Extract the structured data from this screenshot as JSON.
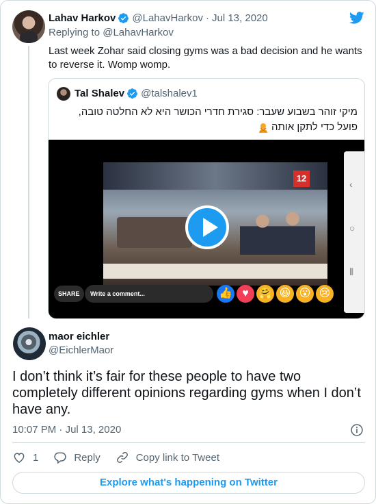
{
  "parent_tweet": {
    "name": "Lahav Harkov",
    "handle": "@LahavHarkov",
    "separator": "·",
    "date": "Jul 13, 2020",
    "replying_prefix": "Replying to",
    "replying_to": "@LahavHarkov",
    "text": "Last week Zohar said closing gyms was a bad decision and he wants to reverse it. Womp womp."
  },
  "quoted_tweet": {
    "name": "Tal Shalev",
    "handle": "@talshalev1",
    "text": "מיקי זוהר בשבוע שעבר: סגירת חדרי הכושר היא לא החלטה טובה, פועל כדי לתקן אותה",
    "video": {
      "share_label": "SHARE",
      "comment_placeholder": "Write a comment..."
    }
  },
  "reply_tweet": {
    "name": "maor eichler",
    "handle": "@EichlerMaor",
    "text": "I don’t think it’s fair for these people to have two completely different opinions regarding gyms when I don’t have any.",
    "time": "10:07 PM",
    "separator": "·",
    "date": "Jul 13, 2020"
  },
  "actions": {
    "like_count": "1",
    "reply_label": "Reply",
    "copy_link_label": "Copy link to Tweet"
  },
  "explore_label": "Explore what's happening on Twitter",
  "colors": {
    "accent": "#1d9bf0",
    "text": "#0f1419",
    "muted": "#536471",
    "border": "#cfd9de"
  },
  "icons": [
    "twitter-bird-icon",
    "verified-badge-icon",
    "play-icon",
    "heart-icon",
    "reply-icon",
    "link-icon",
    "info-icon",
    "person-gesturing-no-emoji"
  ]
}
